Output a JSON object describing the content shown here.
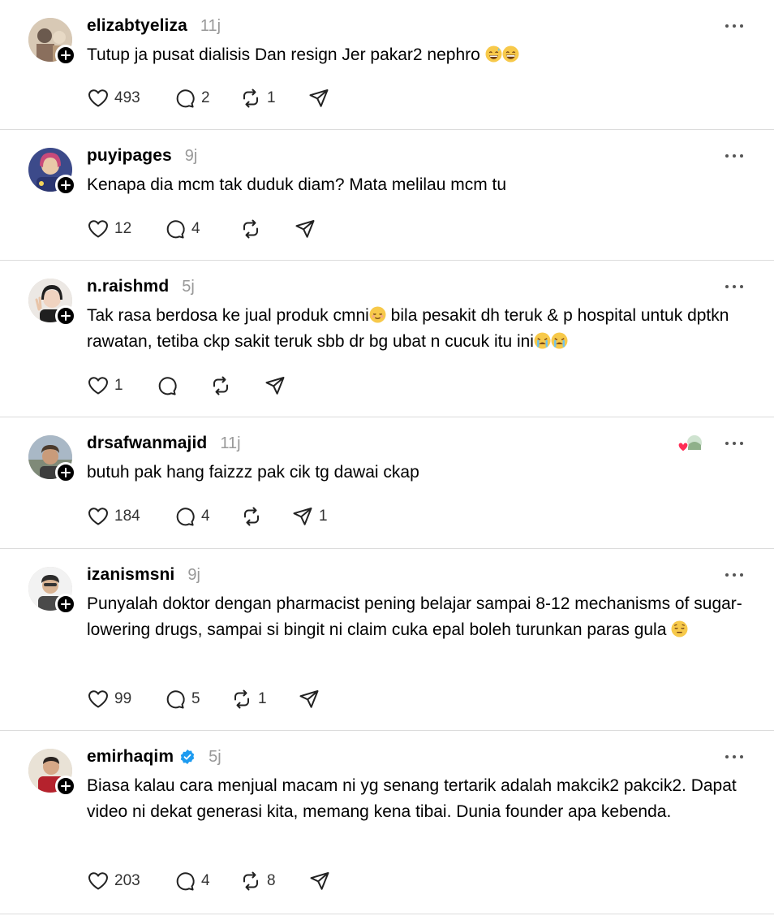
{
  "posts": [
    {
      "username": "elizabtyeliza",
      "time": "11j",
      "verified": false,
      "text": "Tutup ja pusat dialisis Dan resign Jer pakar2 nephro",
      "emoji": [
        "sweat-smile",
        "grin"
      ],
      "likes": "493",
      "replies": "2",
      "reposts": "1",
      "shares": ""
    },
    {
      "username": "puyipages",
      "time": "9j",
      "verified": false,
      "text": "Kenapa dia mcm tak duduk diam? Mata melilau mcm tu",
      "likes": "12",
      "replies": "4",
      "reposts": "",
      "shares": ""
    },
    {
      "username": "n.raishmd",
      "time": "5j",
      "verified": false,
      "text_a": "Tak rasa berdosa ke jual produk cmni",
      "text_b": " bila pesakit dh teruk & p hospital untuk dptkn rawatan, tetiba ckp sakit teruk sbb dr bg ubat n cucuk itu ini",
      "likes": "1",
      "replies": "",
      "reposts": "",
      "shares": ""
    },
    {
      "username": "drsafwanmajid",
      "time": "11j",
      "verified": false,
      "text": "butuh pak hang faizzz pak cik tg dawai ckap",
      "likes": "184",
      "replies": "4",
      "reposts": "",
      "shares": "1"
    },
    {
      "username": "izanismsni",
      "time": "9j",
      "verified": false,
      "text": "Punyalah doktor dengan pharmacist pening belajar sampai 8-12 mechanisms of sugar-lowering drugs, sampai si bingit ni claim cuka epal boleh turunkan paras gula",
      "likes": "99",
      "replies": "5",
      "reposts": "1",
      "shares": ""
    },
    {
      "username": "emirhaqim",
      "time": "5j",
      "verified": true,
      "text": "Biasa kalau cara menjual macam ni yg senang tertarik adalah makcik2 pakcik2. Dapat video ni dekat generasi kita, memang kena tibai. Dunia founder apa kebenda.",
      "likes": "203",
      "replies": "4",
      "reposts": "8",
      "shares": ""
    }
  ],
  "colors": {
    "verified": "#1d9bf0",
    "divider": "#dcdcdc",
    "time": "#999999"
  },
  "icons": [
    "heart-icon",
    "comment-icon",
    "repost-icon",
    "share-icon",
    "more-icon",
    "follow-plus-icon",
    "verified-icon"
  ]
}
